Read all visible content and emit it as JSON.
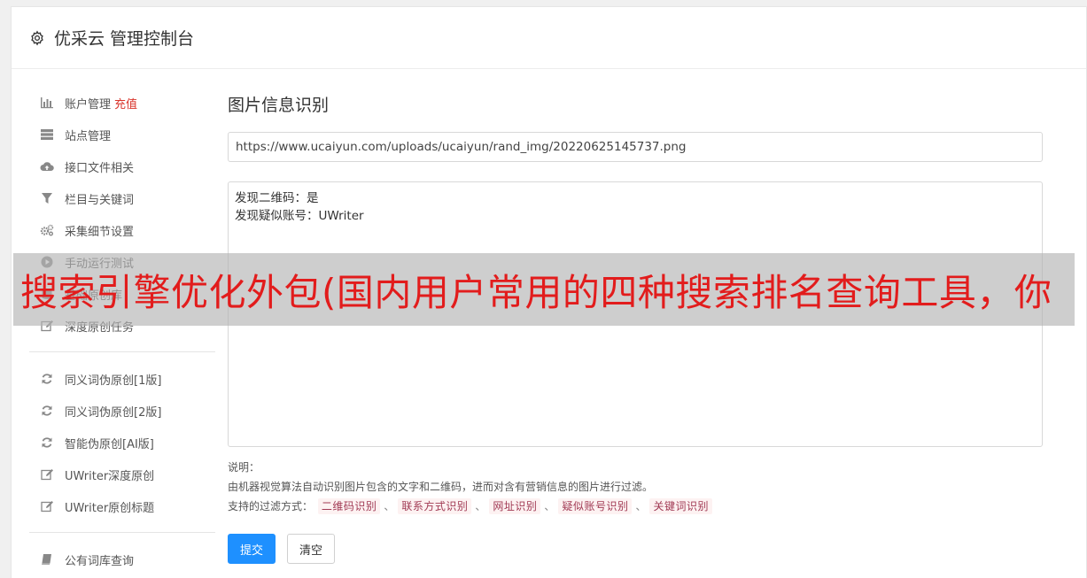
{
  "header": {
    "title": "优采云 管理控制台",
    "icon": "gear-icon"
  },
  "sidebar": {
    "group1": [
      {
        "label": "账户管理",
        "badge": "充值",
        "icon": "bar-chart-icon"
      },
      {
        "label": "站点管理",
        "icon": "server-icon"
      },
      {
        "label": "接口文件相关",
        "icon": "cloud-upload-icon"
      },
      {
        "label": "栏目与关键词",
        "icon": "filter-icon"
      },
      {
        "label": "采集细节设置",
        "icon": "cogs-icon"
      },
      {
        "label": "手动运行测试",
        "icon": "play-icon"
      },
      {
        "label": "基础原创库",
        "icon": "database-icon"
      },
      {
        "label": "深度原创任务",
        "icon": "edit-icon"
      }
    ],
    "group2": [
      {
        "label": "同义词伪原创[1版]",
        "icon": "refresh-icon"
      },
      {
        "label": "同义词伪原创[2版]",
        "icon": "refresh-icon"
      },
      {
        "label": "智能伪原创[AI版]",
        "icon": "refresh-icon"
      },
      {
        "label": "UWriter深度原创",
        "icon": "edit-icon"
      },
      {
        "label": "UWriter原创标题",
        "icon": "edit-icon"
      }
    ],
    "group3": [
      {
        "label": "公有词库查询",
        "icon": "book-icon"
      }
    ]
  },
  "main": {
    "title": "图片信息识别",
    "url_value": "https://www.ucaiyun.com/uploads/ucaiyun/rand_img/20220625145737.png",
    "result_lines": [
      "发现二维码：是",
      "发现疑似账号：UWriter"
    ],
    "notes_label": "说明：",
    "notes_desc": "由机器视觉算法自动识别图片包含的文字和二维码，进而对含有营销信息的图片进行过滤。",
    "filter_label": "支持的过滤方式：",
    "filter_tags": [
      "二维码识别",
      "联系方式识别",
      "网址识别",
      "疑似账号识别",
      "关键词识别"
    ],
    "tag_separator": "、",
    "submit_label": "提交",
    "clear_label": "清空"
  },
  "overlay": {
    "text": "搜索引擎优化外包(国内用户常用的四种搜索排名查询工具，你"
  },
  "colors": {
    "primary": "#1e90ff",
    "badge": "#d9342b",
    "overlay_text": "#e21c1c",
    "tag_text": "#a13a54"
  }
}
